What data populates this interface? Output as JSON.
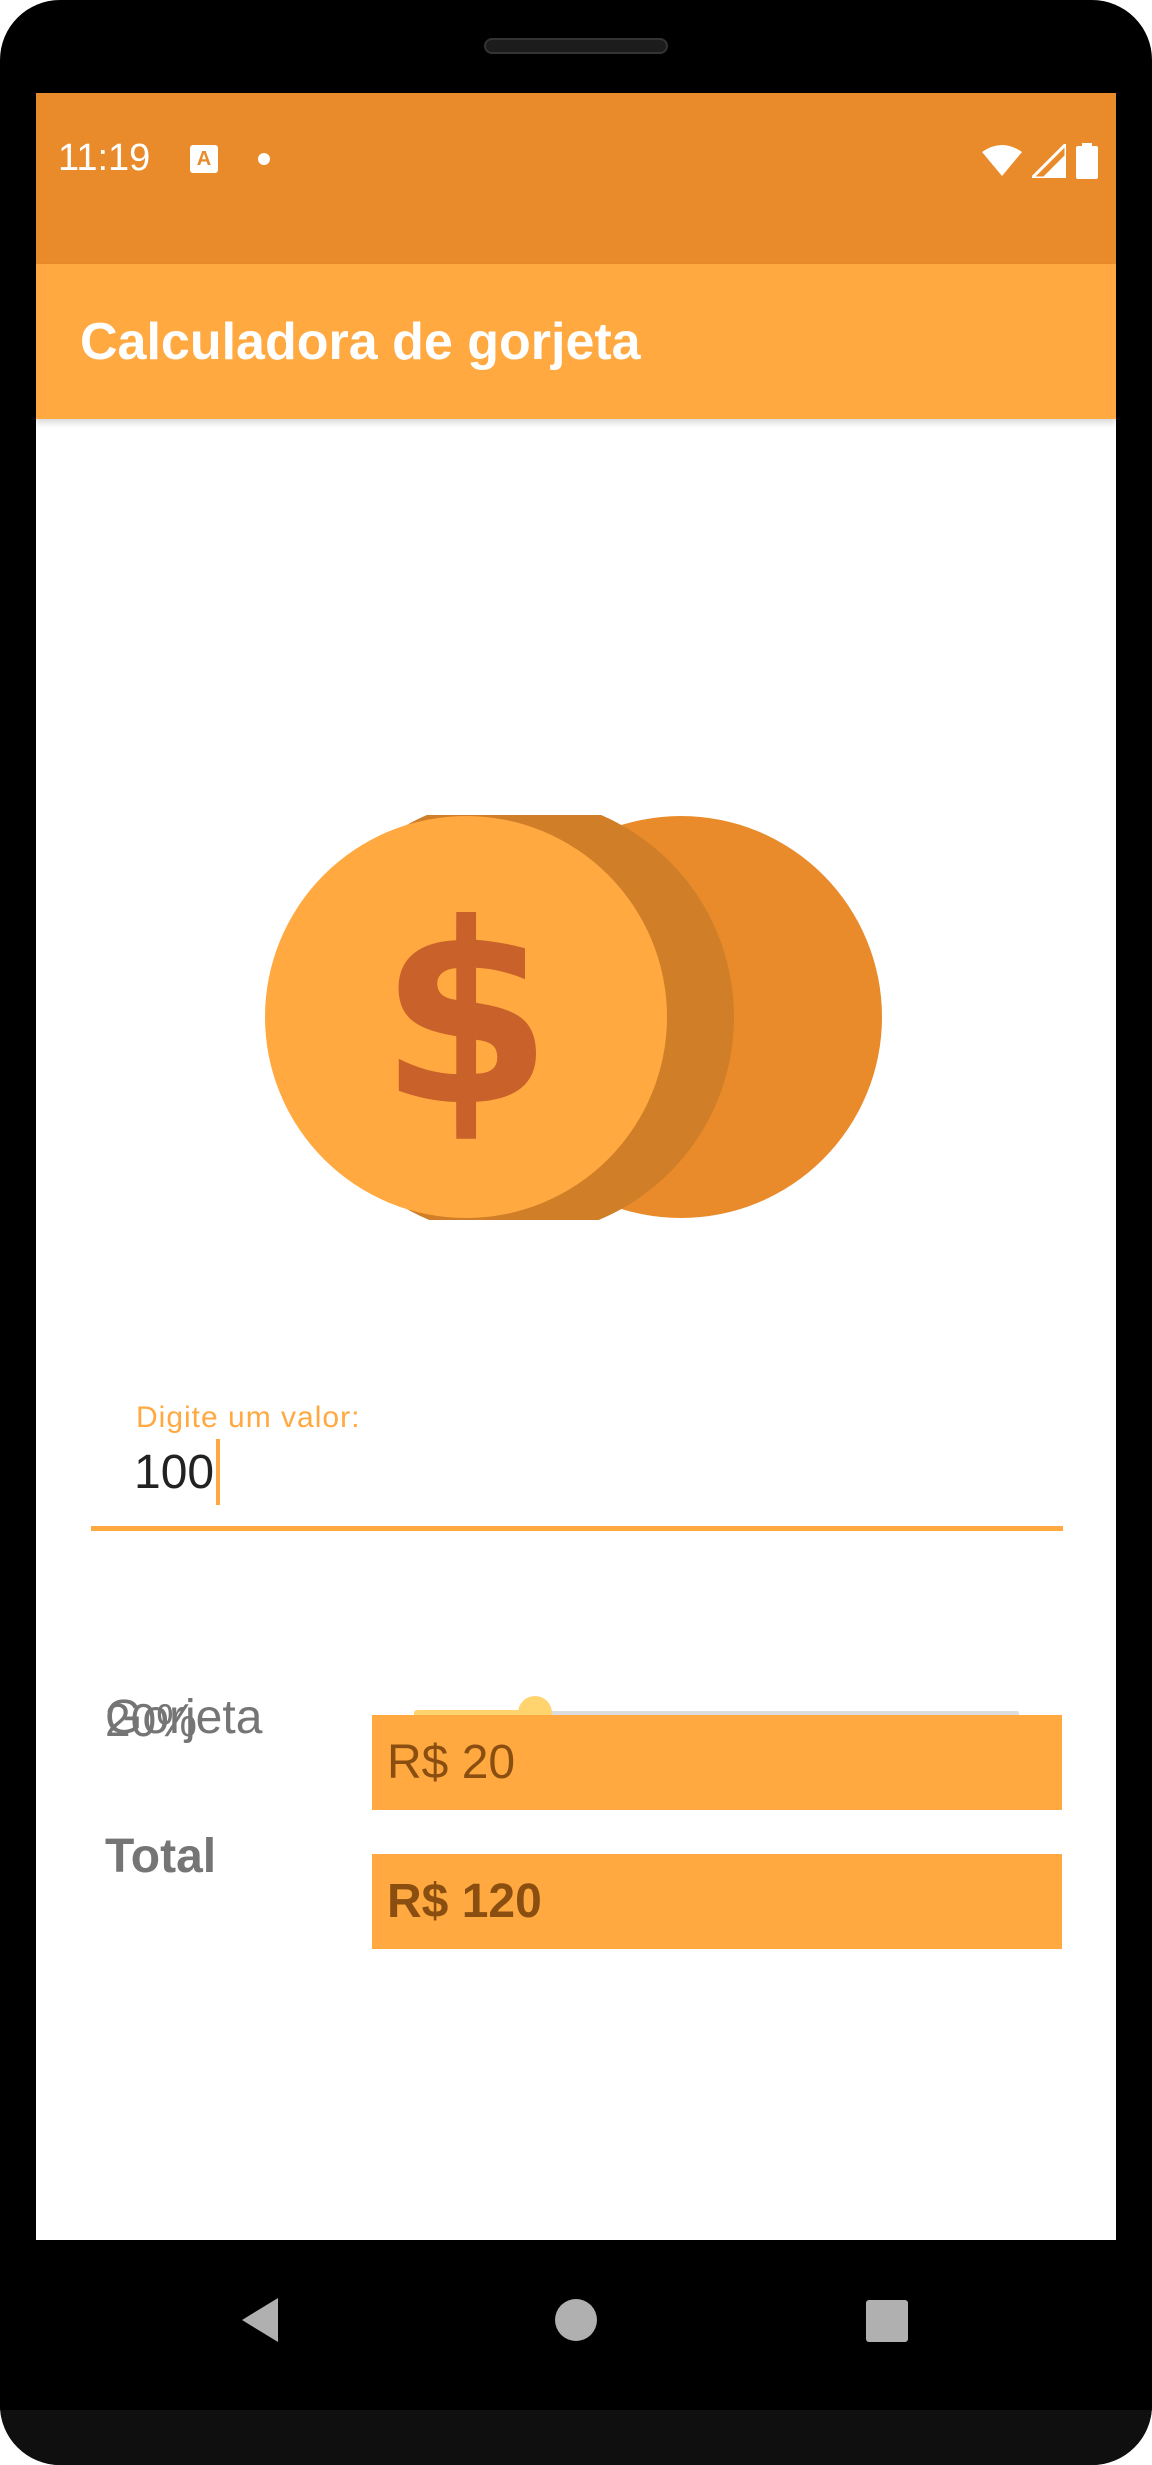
{
  "status_bar": {
    "time": "11:19",
    "notification_icon": "A",
    "icons": [
      "wifi-icon",
      "signal-icon",
      "battery-icon"
    ]
  },
  "app_bar": {
    "title": "Calculadora de gorjeta"
  },
  "illustration": {
    "icon": "coins-dollar-icon",
    "symbol": "$"
  },
  "amount_field": {
    "label": "Digite um valor:",
    "value": "100"
  },
  "tip_slider": {
    "label": "20%",
    "value_fraction": 0.2
  },
  "tip_row": {
    "label": "Gorjeta",
    "value": "R$ 20"
  },
  "total_row": {
    "label": "Total",
    "value": "R$ 120"
  },
  "nav": {
    "buttons": [
      "back-icon",
      "home-icon",
      "recents-icon"
    ]
  },
  "colors": {
    "status_bar": "#E98B2A",
    "primary": "#FFA940",
    "slider": "#FFD36E",
    "dollar": "#C8612A"
  }
}
